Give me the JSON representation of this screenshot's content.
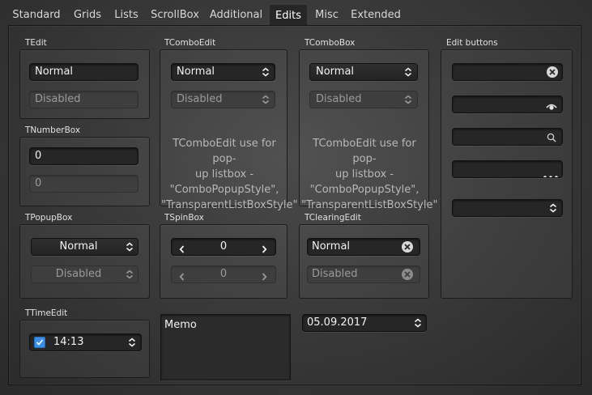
{
  "tabs": [
    {
      "label": "Standard",
      "active": false
    },
    {
      "label": "Grids",
      "active": false
    },
    {
      "label": "Lists",
      "active": false
    },
    {
      "label": "ScrollBox",
      "active": false
    },
    {
      "label": "Additional",
      "active": false
    },
    {
      "label": "Edits",
      "active": true
    },
    {
      "label": "Misc",
      "active": false
    },
    {
      "label": "Extended",
      "active": false
    }
  ],
  "tedit": {
    "title": "TEdit",
    "normal_value": "Normal",
    "disabled_value": "Disabled"
  },
  "tnumberbox": {
    "title": "TNumberBox",
    "normal_value": "0",
    "disabled_value": "0"
  },
  "tcomboedit": {
    "title": "TComboEdit",
    "normal_value": "Normal",
    "disabled_value": "Disabled",
    "note": [
      "TComboEdit use for pop-",
      "up listbox -",
      "\"ComboPopupStyle\",",
      "\"TransparentListBoxStyle\""
    ]
  },
  "tcombobox": {
    "title": "TComboBox",
    "normal_value": "Normal",
    "disabled_value": "Disabled",
    "note": [
      "TComboEdit use for pop-",
      "up listbox -",
      "\"ComboPopupStyle\",",
      "\"TransparentListBoxStyle\""
    ]
  },
  "editbuttons": {
    "title": "Edit buttons",
    "icons": [
      "clear-icon",
      "eye-icon",
      "search-icon",
      "ellipsis-icon",
      "up-down-arrows-icon"
    ]
  },
  "tpopupbox": {
    "title": "TPopupBox",
    "normal_value": "Normal",
    "disabled_value": "Disabled"
  },
  "tspinbox": {
    "title": "TSpinBox",
    "normal_value": "0",
    "disabled_value": "0"
  },
  "tclearingedit": {
    "title": "TClearingEdit",
    "normal_value": "Normal",
    "disabled_value": "Disabled"
  },
  "ttimeedit": {
    "title": "TTimeEdit",
    "value": "14:13",
    "checked": true
  },
  "memo": {
    "value": "Memo"
  },
  "dateedit": {
    "value": "05.09.2017"
  },
  "colors": {
    "accent": "#3a8ee6",
    "background": "#3a3a3a",
    "field": "#262626",
    "disabled_field": "#3e3e3e"
  }
}
